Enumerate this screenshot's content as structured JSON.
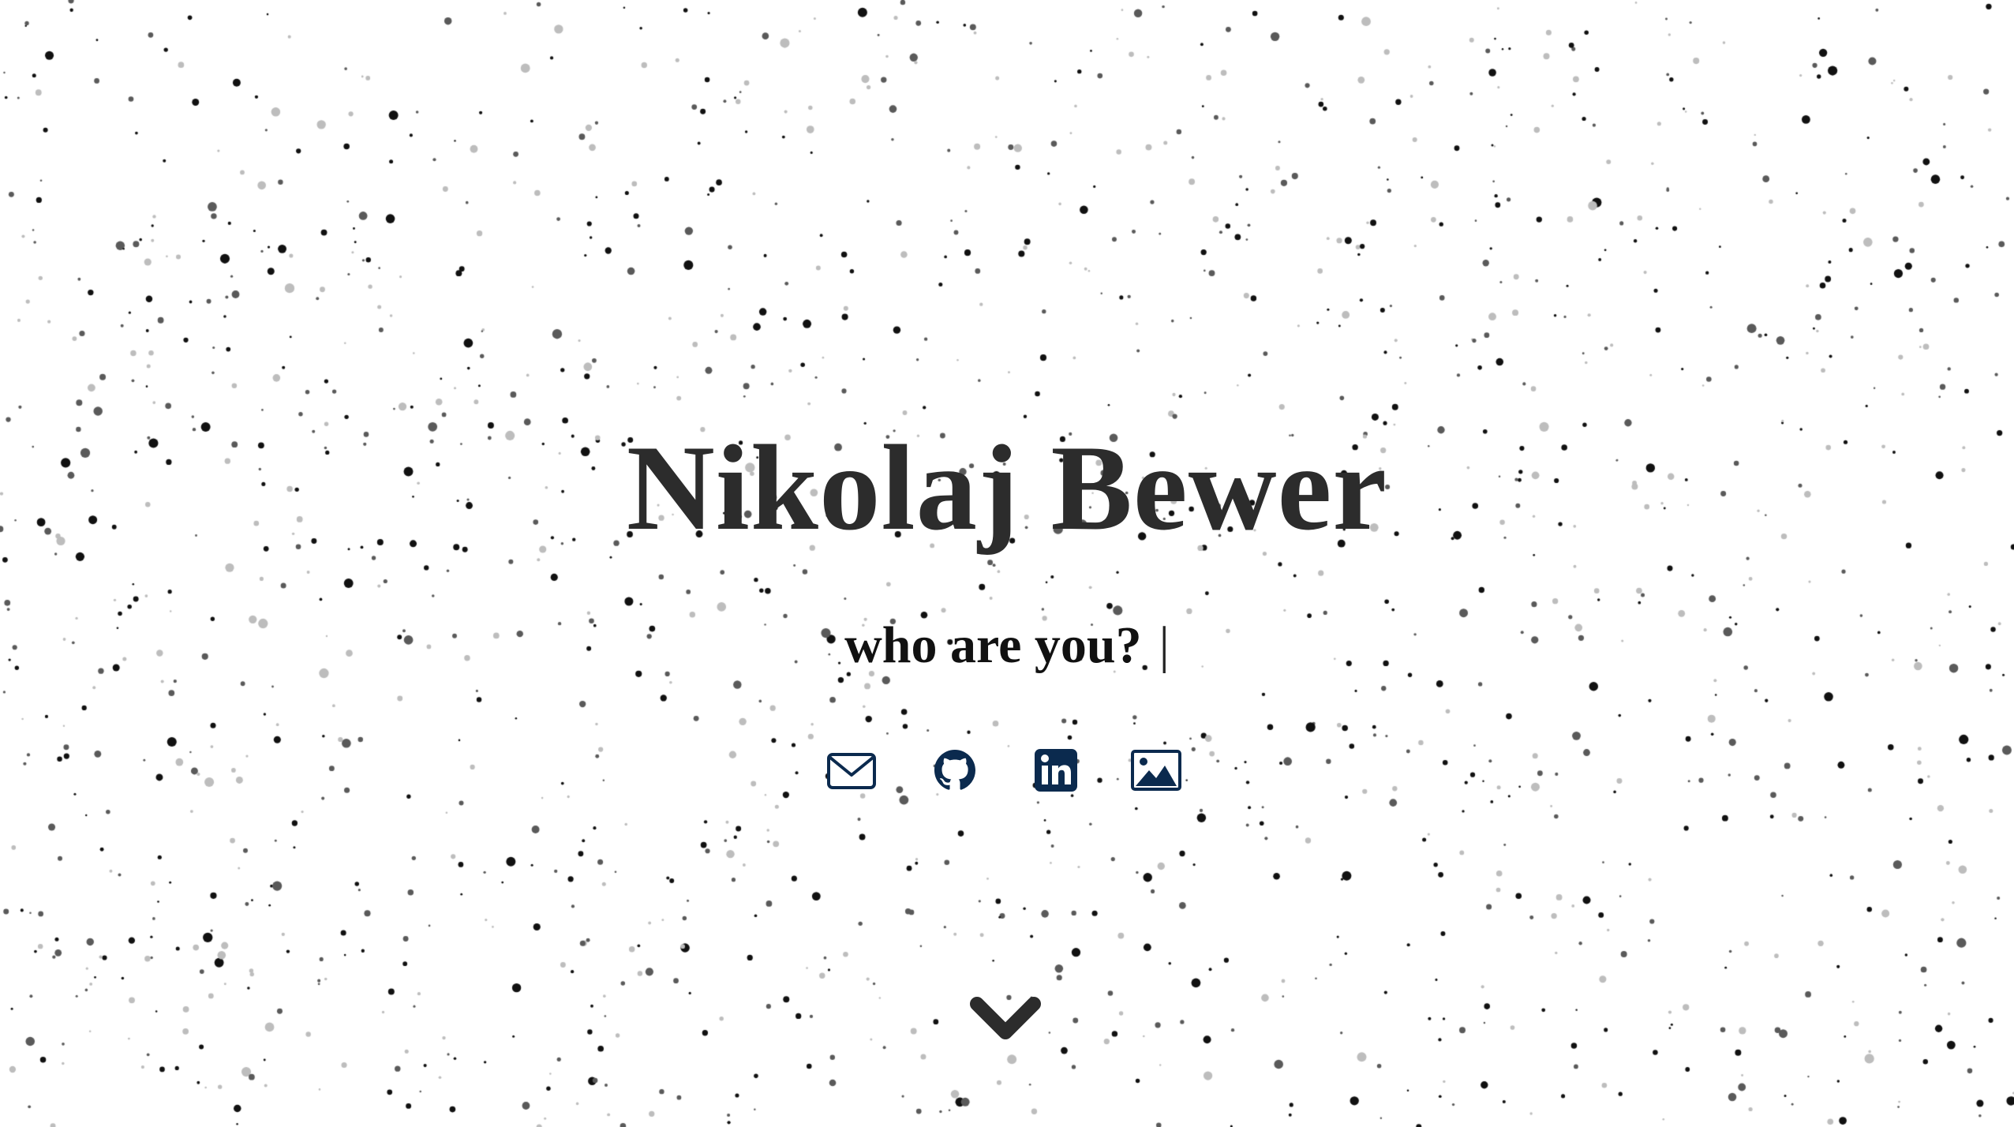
{
  "hero": {
    "name": "Nikolaj Bewer",
    "tagline": "who are you?",
    "caret": "|"
  },
  "socials": [
    {
      "id": "email",
      "icon": "envelope-icon"
    },
    {
      "id": "github",
      "icon": "github-icon"
    },
    {
      "id": "linkedin",
      "icon": "linkedin-icon"
    },
    {
      "id": "gallery",
      "icon": "image-icon"
    }
  ],
  "scroll": {
    "icon": "chevron-down-icon"
  },
  "colors": {
    "background": "#ffffff",
    "name_text": "#2c2c2c",
    "tagline_text": "#111111",
    "icon_navy": "#0b2a4e",
    "chevron": "#2c2c2c",
    "particle_dark": "#111111",
    "particle_mid": "#5a5a5a",
    "particle_light": "#bdbdbd"
  }
}
